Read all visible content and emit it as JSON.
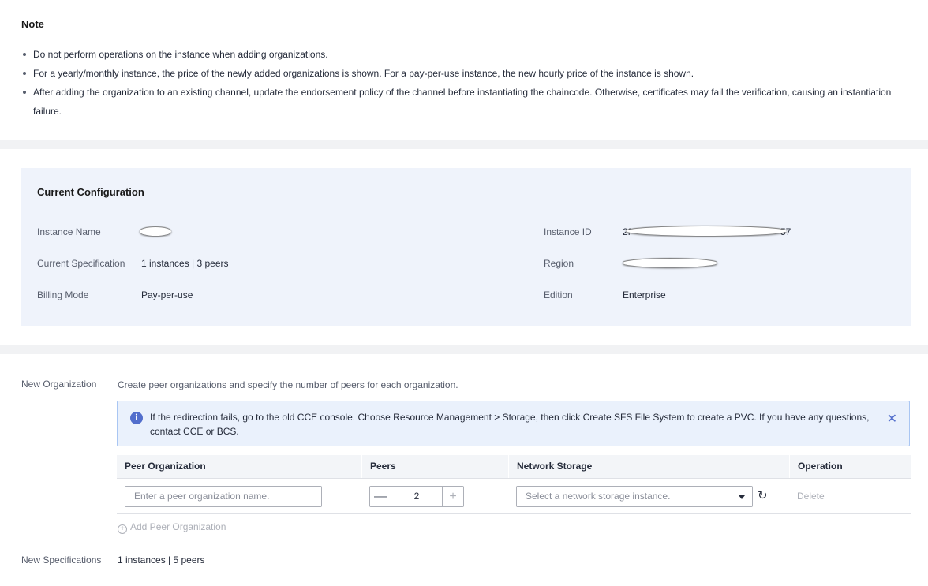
{
  "note": {
    "title": "Note",
    "items": [
      "Do not perform operations on the instance when adding organizations.",
      "For a yearly/monthly instance, the price of the newly added organizations is shown. For a pay-per-use instance, the new hourly price of the instance is shown.",
      "After adding the organization to an existing channel, update the endorsement policy of the channel before instantiating the chaincode. Otherwise, certificates may fail the verification, causing an instantiation failure."
    ]
  },
  "config": {
    "title": "Current Configuration",
    "instance_name_label": "Instance Name",
    "current_spec_label": "Current Specification",
    "current_spec_value": "1 instances | 3 peers",
    "billing_mode_label": "Billing Mode",
    "billing_mode_value": "Pay-per-use",
    "instance_id_label": "Instance ID",
    "instance_id_prefix": "2f",
    "instance_id_suffix": "57",
    "region_label": "Region",
    "edition_label": "Edition",
    "edition_value": "Enterprise"
  },
  "new_org": {
    "label": "New Organization",
    "description": "Create peer organizations and specify the number of peers for each organization.",
    "alert_text": "If the redirection fails, go to the old CCE console. Choose Resource Management > Storage, then click Create SFS File System to create a PVC. If you have any questions, contact CCE or BCS.",
    "table_headers": {
      "peer_org": "Peer Organization",
      "peers": "Peers",
      "network_storage": "Network Storage",
      "operation": "Operation"
    },
    "row": {
      "org_placeholder": "Enter a peer organization name.",
      "peers_value": "2",
      "storage_placeholder": "Select a network storage instance.",
      "delete_label": "Delete"
    },
    "add_peer_label": "Add Peer Organization"
  },
  "new_spec": {
    "label": "New Specifications",
    "value": "1 instances | 5 peers"
  },
  "colors": {
    "accent": "#526ecc",
    "card_bg": "#eff3fb",
    "alert_bg": "#eaf1fc"
  },
  "icons": [
    "info-icon",
    "close-icon",
    "minus-icon",
    "plus-icon",
    "chevron-down-icon",
    "refresh-icon",
    "add-circle-icon"
  ]
}
